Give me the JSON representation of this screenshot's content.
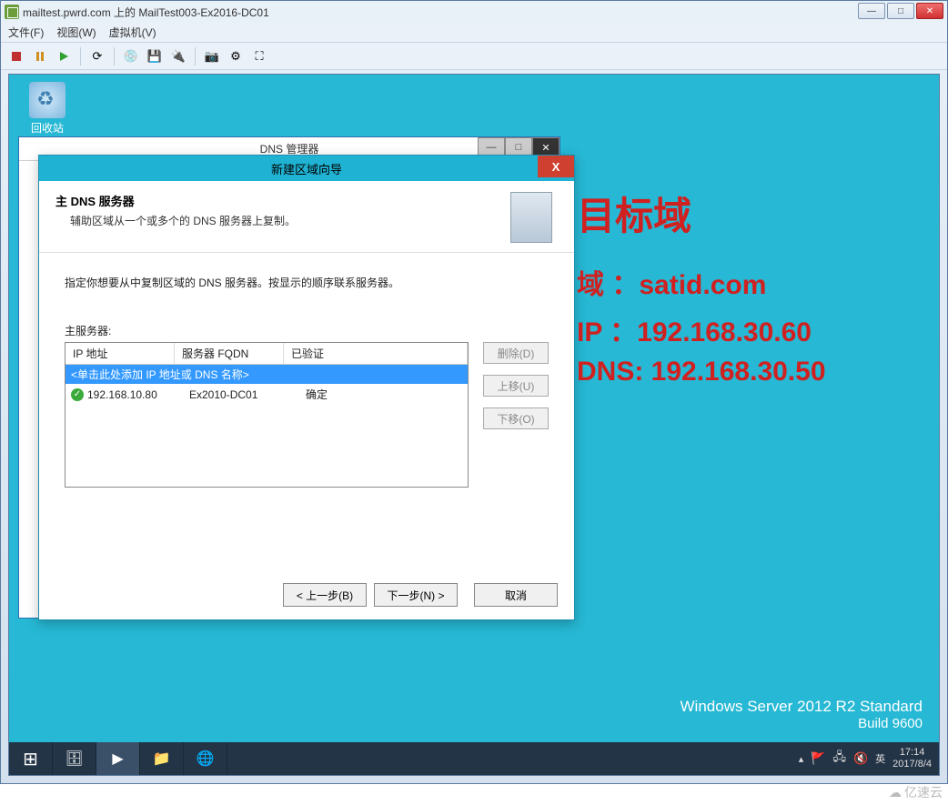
{
  "outer": {
    "title": "mailtest.pwrd.com 上的 MailTest003-Ex2016-DC01",
    "menus": [
      "文件(F)",
      "视图(W)",
      "虚拟机(V)"
    ]
  },
  "desktop": {
    "recycle_label": "回收站"
  },
  "dns_window": {
    "title": "DNS 管理器"
  },
  "wizard": {
    "title": "新建区域向导",
    "header_title": "主 DNS 服务器",
    "header_sub": "辅助区域从一个或多个的 DNS 服务器上复制。",
    "instruction": "指定你想要从中复制区域的 DNS 服务器。按显示的顺序联系服务器。",
    "list_label": "主服务器:",
    "columns": {
      "ip": "IP 地址",
      "fqdn": "服务器 FQDN",
      "validated": "已验证"
    },
    "input_placeholder": "<单击此处添加 IP 地址或 DNS 名称>",
    "row": {
      "ip": "192.168.10.80",
      "fqdn": "Ex2010-DC01",
      "validated": "确定"
    },
    "side_buttons": {
      "delete": "删除(D)",
      "up": "上移(U)",
      "down": "下移(O)"
    },
    "footer": {
      "back": "< 上一步(B)",
      "next": "下一步(N) >",
      "cancel": "取消"
    }
  },
  "annotation": {
    "title": "目标域",
    "line1": "域 ：satid.com",
    "line2": "IP ：192.168.30.60",
    "line3": "DNS: 192.168.30.50"
  },
  "os": {
    "brand": "Windows Server 2012 R2 Standard",
    "build": "Build 9600"
  },
  "tray": {
    "ime": "英",
    "time": "17:14",
    "date": "2017/8/4"
  },
  "watermark": "亿速云"
}
